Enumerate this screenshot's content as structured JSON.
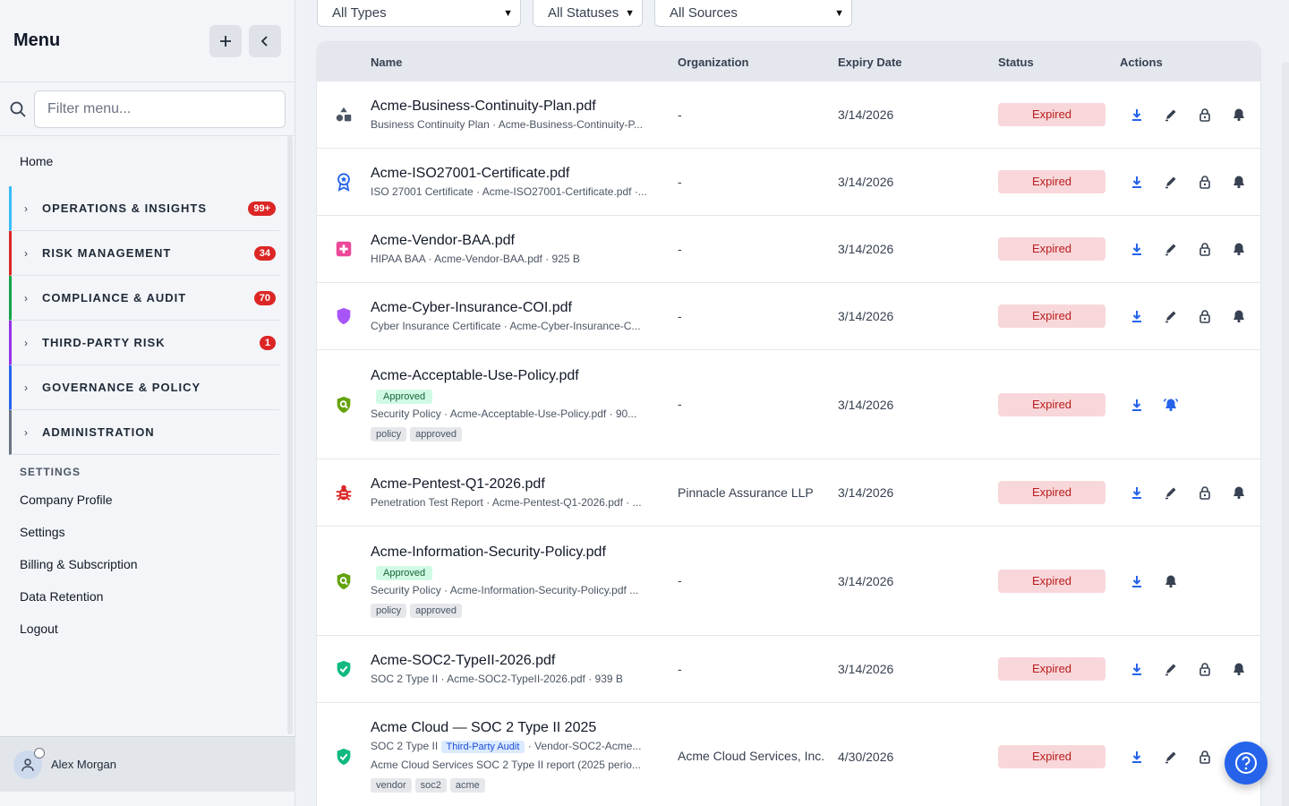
{
  "sidebar": {
    "title": "Menu",
    "add_icon": "plus-icon",
    "collapse_icon": "chevron-left-icon",
    "filter_placeholder": "Filter menu...",
    "home": "Home",
    "groups": [
      {
        "label": "OPERATIONS & INSIGHTS",
        "badge": "99+",
        "color": "#38bdf8"
      },
      {
        "label": "RISK MANAGEMENT",
        "badge": "34",
        "color": "#dc2626"
      },
      {
        "label": "COMPLIANCE & AUDIT",
        "badge": "70",
        "color": "#16a34a"
      },
      {
        "label": "THIRD-PARTY RISK",
        "badge": "1",
        "color": "#9333ea"
      },
      {
        "label": "GOVERNANCE & POLICY",
        "badge": "",
        "color": "#2563eb"
      },
      {
        "label": "ADMINISTRATION",
        "badge": "",
        "color": "#6b7280"
      }
    ],
    "settings_label": "SETTINGS",
    "settings_links": [
      "Company Profile",
      "Settings",
      "Billing & Subscription",
      "Data Retention",
      "Logout"
    ],
    "user": "Alex Morgan"
  },
  "filters": {
    "types": "All Types",
    "statuses": "All Statuses",
    "sources": "All Sources"
  },
  "table": {
    "headers": {
      "name": "Name",
      "org": "Organization",
      "expiry": "Expiry Date",
      "status": "Status",
      "actions": "Actions"
    },
    "rows": [
      {
        "icon": "shapes-icon",
        "icon_color": "#4b5563",
        "name": "Acme-Business-Continuity-Plan.pdf",
        "sub": "Business Continuity Plan · Acme-Business-Continuity-P...",
        "org": "-",
        "expiry": "3/14/2026",
        "status": "Expired"
      },
      {
        "icon": "award-icon",
        "icon_color": "#2563eb",
        "name": "Acme-ISO27001-Certificate.pdf",
        "sub": "ISO 27001 Certificate · Acme-ISO27001-Certificate.pdf ·...",
        "org": "-",
        "expiry": "3/14/2026",
        "status": "Expired"
      },
      {
        "icon": "medical-cross-icon",
        "icon_color": "#ec4899",
        "name": "Acme-Vendor-BAA.pdf",
        "sub": "HIPAA BAA · Acme-Vendor-BAA.pdf · 925 B",
        "org": "-",
        "expiry": "3/14/2026",
        "status": "Expired"
      },
      {
        "icon": "shield-icon",
        "icon_color": "#a855f7",
        "name": "Acme-Cyber-Insurance-COI.pdf",
        "sub": "Cyber Insurance Certificate · Acme-Cyber-Insurance-C...",
        "org": "-",
        "expiry": "3/14/2026",
        "status": "Expired"
      },
      {
        "icon": "shield-search-icon",
        "icon_color": "#65a30d",
        "name": "Acme-Acceptable-Use-Policy.pdf",
        "approved": "Approved",
        "sub": "Security Policy · Acme-Acceptable-Use-Policy.pdf · 90...",
        "tags": [
          "policy",
          "approved"
        ],
        "org": "-",
        "expiry": "3/14/2026",
        "status": "Expired"
      },
      {
        "icon": "bug-icon",
        "icon_color": "#dc2626",
        "name": "Acme-Pentest-Q1-2026.pdf",
        "sub": "Penetration Test Report · Acme-Pentest-Q1-2026.pdf · ...",
        "org": "Pinnacle Assurance LLP",
        "expiry": "3/14/2026",
        "status": "Expired"
      },
      {
        "icon": "shield-search-icon",
        "icon_color": "#65a30d",
        "name": "Acme-Information-Security-Policy.pdf",
        "approved": "Approved",
        "sub": "Security Policy · Acme-Information-Security-Policy.pdf ...",
        "tags": [
          "policy",
          "approved"
        ],
        "org": "-",
        "expiry": "3/14/2026",
        "status": "Expired"
      },
      {
        "icon": "shield-check-icon",
        "icon_color": "#10b981",
        "name": "Acme-SOC2-TypeII-2026.pdf",
        "sub": "SOC 2 Type II · Acme-SOC2-TypeII-2026.pdf · 939 B",
        "org": "-",
        "expiry": "3/14/2026",
        "status": "Expired"
      },
      {
        "icon": "shield-check-icon",
        "icon_color": "#10b981",
        "name": "Acme Cloud — SOC 2 Type II 2025",
        "sub_a": "SOC 2 Type II",
        "third_party": "Third-Party Audit",
        "sub_b": "· Vendor-SOC2-Acme...",
        "sub2": "Acme Cloud Services SOC 2 Type II report (2025 perio...",
        "tags": [
          "vendor",
          "soc2",
          "acme"
        ],
        "org": "Acme Cloud Services, Inc.",
        "expiry": "4/30/2026",
        "status": "Expired"
      }
    ]
  },
  "help_icon": "help-circle-icon"
}
